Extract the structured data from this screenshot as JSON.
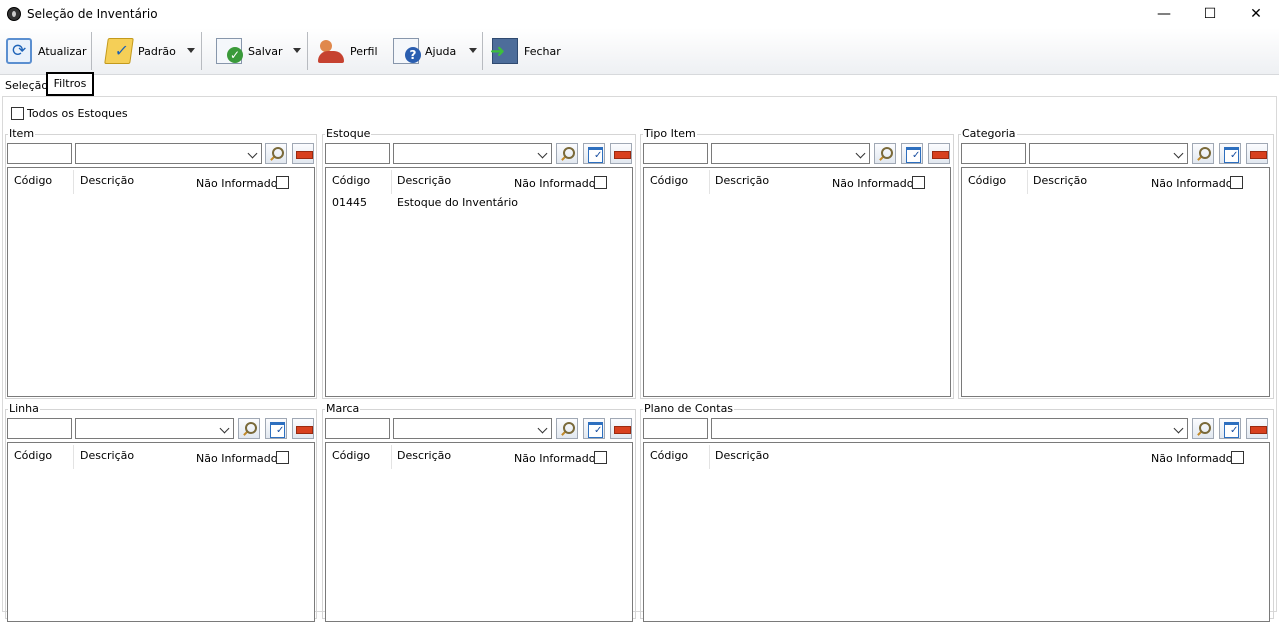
{
  "window": {
    "title": "Seleção de Inventário",
    "minimize": "—",
    "maximize": "☐",
    "close": "✕"
  },
  "toolbar": {
    "refresh": "Atualizar",
    "default": "Padrão",
    "save": "Salvar",
    "profile": "Perfil",
    "help": "Ajuda",
    "close": "Fechar"
  },
  "tabs": [
    {
      "label": "Seleção"
    },
    {
      "label": "Filtros"
    }
  ],
  "filters": {
    "all_stocks_label": "Todos os Estoques"
  },
  "columns": {
    "code": "Código",
    "description": "Descrição",
    "not_informed": "Não Informado"
  },
  "groups": {
    "item": {
      "title": "Item"
    },
    "estoque": {
      "title": "Estoque",
      "rows": [
        {
          "code": "01445",
          "description": "Estoque do Inventário"
        }
      ]
    },
    "tipo_item": {
      "title": "Tipo Item"
    },
    "categoria": {
      "title": "Categoria"
    },
    "linha": {
      "title": "Linha"
    },
    "marca": {
      "title": "Marca"
    },
    "plano_contas": {
      "title": "Plano de Contas"
    }
  }
}
